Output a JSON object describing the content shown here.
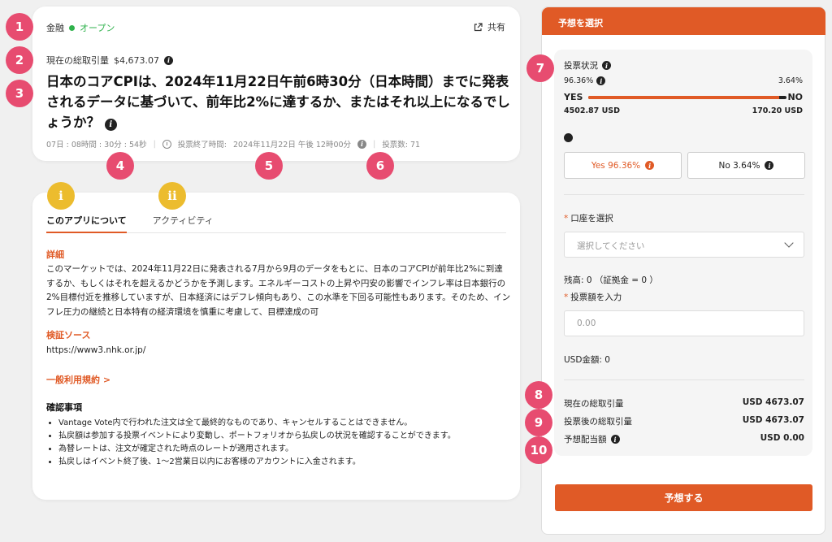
{
  "market": {
    "category": "金融",
    "status": "オープン",
    "share_label": "共有",
    "volume_label": "現在の総取引量",
    "volume_value": "$4,673.07",
    "title": "日本のコアCPIは、2024年11月22日午前6時30分（日本時間）までに発表されるデータに基づいて、前年比2%に達するか、またはそれ以上になるでしょうか？",
    "countdown": "07日 : 08時間 : 30分 : 54秒",
    "end_label": "投票終了時間:",
    "end_value": "2024年11月22日 午後 12時00分",
    "votes_label": "投票数: 71"
  },
  "tabs": [
    {
      "label": "このアプリについて"
    },
    {
      "label": "アクティビティ"
    }
  ],
  "details": {
    "heading": "詳細",
    "body": "このマーケットでは、2024年11月22日に発表される7月から9月のデータをもとに、日本のコアCPIが前年比2%に到達するか、もしくはそれを超えるかどうかを予測します。エネルギーコストの上昇や円安の影響でインフレ率は日本銀行の2%目標付近を推移していますが、日本経済にはデフレ傾向もあり、この水準を下回る可能性もあります。そのため、インフレ圧力の継続と日本特有の経済環境を慎重に考慮して、目標達成の可",
    "source_heading": "検証ソース",
    "source_url": "https://www3.nhk.or.jp/",
    "terms_link": "一般利用規約 >",
    "confirm_heading": "確認事項",
    "rules": [
      "Vantage Vote内で行われた注文は全て最終的なものであり、キャンセルすることはできません。",
      "払戻額は参加する投票イベントにより変動し、ポートフォリオから払戻しの状況を確認することができます。",
      "為替レートは、注文が確定された時点のレートが適用されます。",
      "払戻しはイベント終了後、1～2営業日以内にお客様のアカウントに入金されます。"
    ]
  },
  "panel": {
    "header": "予想を選択",
    "vote_status_label": "投票状況",
    "yes_pct": "96.36%",
    "no_pct": "3.64%",
    "yes_label": "YES",
    "no_label": "NO",
    "yes_usd": "4502.87 USD",
    "no_usd": "170.20 USD",
    "yes_fraction": 0.9636,
    "yes_button": "Yes 96.36%",
    "no_button": "No 3.64%",
    "account_label": "口座を選択",
    "account_placeholder": "選択してください",
    "balance": "残高:  0 （証拠金 = 0 ）",
    "amount_label": "投票額を入力",
    "amount_placeholder": "0.00",
    "usd_amount": "USD金額:  0",
    "current_volume_label": "現在の総取引量",
    "current_volume_value": "USD 4673.07",
    "after_volume_label": "投票後の総取引量",
    "after_volume_value": "USD 4673.07",
    "payout_label": "予想配当額",
    "payout_value": "USD 0.00",
    "submit": "予想する"
  },
  "markers": {
    "m1": "1",
    "m2": "2",
    "m3": "3",
    "m4": "4",
    "m5": "5",
    "m6": "6",
    "m7": "7",
    "m8": "8",
    "m9": "9",
    "m10": "10",
    "mi": "i",
    "mii": "ii"
  },
  "colors": {
    "accent": "#e05a26",
    "open": "#2fb24c",
    "marker_pink": "#e74c70",
    "marker_yellow": "#ecbc2e"
  }
}
